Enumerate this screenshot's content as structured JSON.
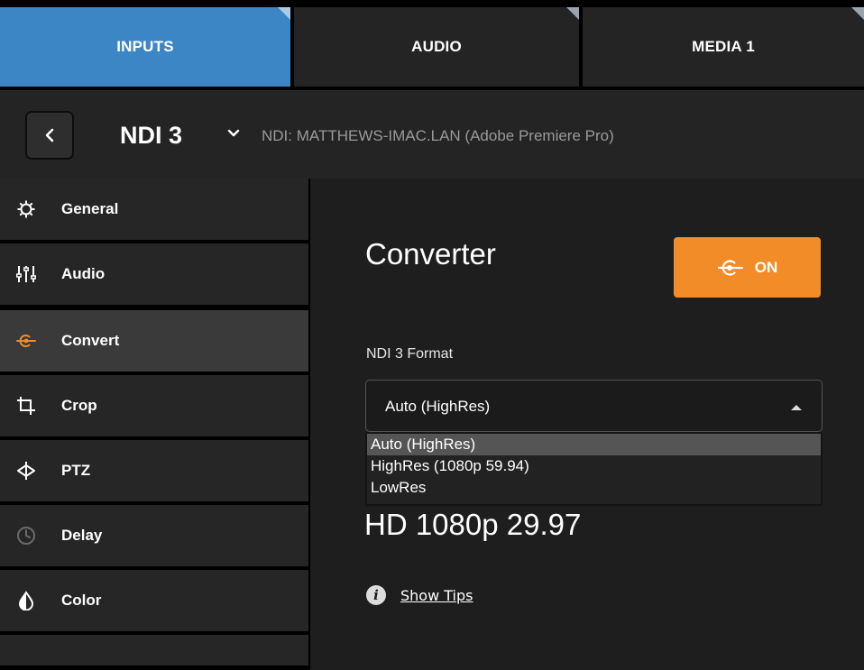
{
  "tabs": [
    {
      "label": "INPUTS",
      "active": true
    },
    {
      "label": "AUDIO",
      "active": false
    },
    {
      "label": "MEDIA 1",
      "active": false
    }
  ],
  "header": {
    "source_title": "NDI 3",
    "source_subtitle": "NDI: MATTHEWS-IMAC.LAN (Adobe Premiere Pro)"
  },
  "sidebar": {
    "items": [
      {
        "label": "General",
        "icon": "gear-icon"
      },
      {
        "label": "Audio",
        "icon": "mixer-sliders-icon"
      },
      {
        "label": "Convert",
        "icon": "converter-icon",
        "active": true
      },
      {
        "label": "Crop",
        "icon": "crop-icon"
      },
      {
        "label": "PTZ",
        "icon": "ptz-icon"
      },
      {
        "label": "Delay",
        "icon": "clock-icon"
      },
      {
        "label": "Color",
        "icon": "droplet-icon"
      }
    ]
  },
  "main": {
    "title": "Converter",
    "toggle_label": "ON",
    "format_label": "NDI 3 Format",
    "select_value": "Auto (HighRes)",
    "options": [
      "Auto (HighRes)",
      "HighRes (1080p 59.94)",
      "LowRes"
    ],
    "selected_option_index": 0,
    "resolution": "HD 1080p 29.97",
    "tips_label": "Show Tips"
  },
  "colors": {
    "accent_blue": "#3d86c6",
    "accent_orange": "#f28c28",
    "panel": "#242424",
    "background": "#1e1e1e"
  }
}
